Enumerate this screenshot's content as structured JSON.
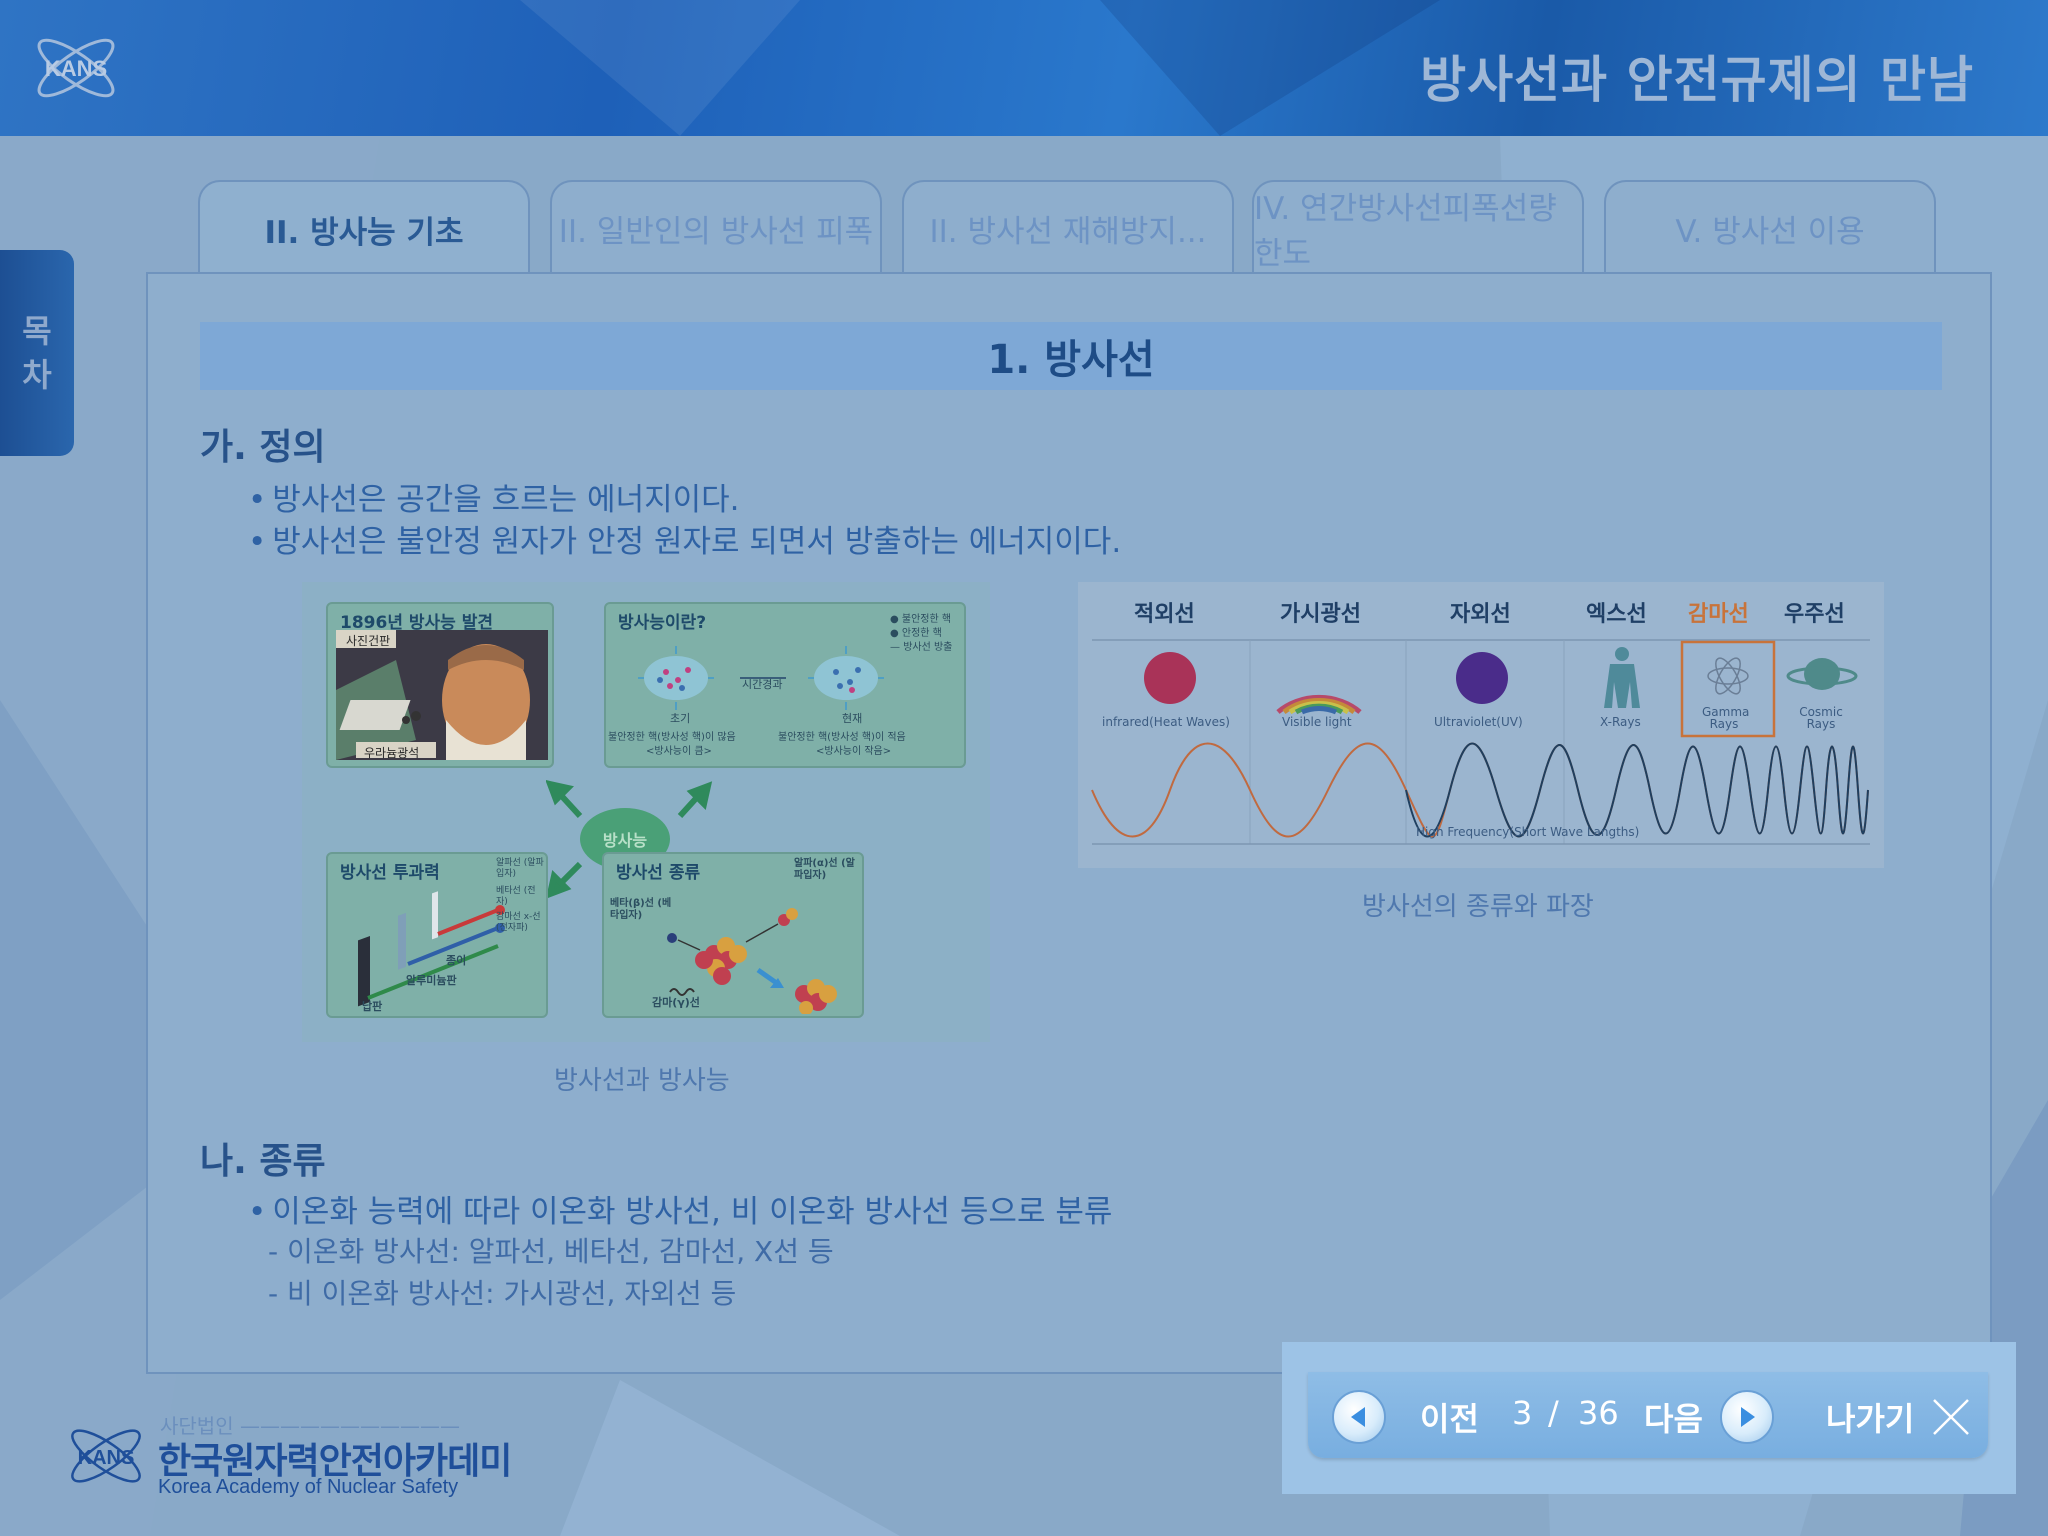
{
  "header": {
    "logo_text": "KANS",
    "title": "방사선과 안전규제의 만남"
  },
  "side_toc": {
    "line1": "목",
    "line2": "차"
  },
  "tabs": [
    {
      "label": "II. 방사능 기초",
      "active": true
    },
    {
      "label": "II. 일반인의 방사선 피폭",
      "active": false
    },
    {
      "label": "II. 방사선 재해방지...",
      "active": false
    },
    {
      "label": "IV. 연간방사선피폭선량한도",
      "active": false
    },
    {
      "label": "V. 방사선 이용",
      "active": false
    }
  ],
  "content": {
    "section_title": "1. 방사선",
    "definition": {
      "heading": "가. 정의",
      "bullets": [
        "방사선은 공간을 흐르는 에너지이다.",
        "방사선은 불안정 원자가 안정 원자로 되면서 방출하는 에너지이다."
      ]
    },
    "figure1": {
      "caption": "방사선과 방사능",
      "hub": "방사능",
      "card_discovery": {
        "title": "1896년 방사능 발견",
        "label_top": "사진건판",
        "label_bottom": "우라늄광석"
      },
      "card_what": {
        "title": "방사능이란?",
        "legend": [
          "불안정한 핵",
          "안정한 핵",
          "방사선 방출"
        ],
        "time_label": "시간경과",
        "left_label": "초기",
        "left_desc1": "불안정한 핵(방사성 핵)이 많음",
        "left_desc2": "<방사능이 큼>",
        "right_label": "현재",
        "right_desc1": "불안정한 핵(방사성 핵)이 적음",
        "right_desc2": "<방사능이 작음>"
      },
      "card_penetration": {
        "title": "방사선 투과력",
        "labels": [
          "알파선 (알파입자)",
          "베타선 (전자)",
          "감마선 x-선 (전자파)"
        ],
        "paper": "종이",
        "aluminum": "알루미늄판",
        "lead": "납판"
      },
      "card_types": {
        "title": "방사선 종류",
        "alpha": "알파(α)선 (알파입자)",
        "beta": "베타(β)선 (베타입자)",
        "gamma": "감마(γ)선"
      }
    },
    "figure2": {
      "caption": "방사선의 종류와 파장",
      "headers": [
        "적외선",
        "가시광선",
        "자외선",
        "엑스선",
        "감마선",
        "우주선"
      ],
      "labels": [
        "infrared(Heat Waves)",
        "Visible light",
        "Ultraviolet(UV)",
        "X-Rays",
        "Gamma Rays",
        "Cosmic Rays"
      ],
      "bottom_label": "High Frequency(Short Wave Langths)",
      "highlight_color": "#c8733a"
    },
    "types": {
      "heading": "나. 종류",
      "bullet": "이온화 능력에 따라 이온화 방사선, 비 이온화 방사선 등으로 분류",
      "sub1": "- 이온화 방사선: 알파선, 베타선, 감마선, X선 등",
      "sub2": "- 비 이온화 방사선: 가시광선, 자외선 등"
    }
  },
  "nav": {
    "prev_label": "이전",
    "current_page": "3",
    "separator": "/",
    "total_pages": "36",
    "next_label": "다음",
    "exit_label": "나가기"
  },
  "footer": {
    "small": "사단법인",
    "name_kr": "한국원자력안전아카데미",
    "name_en": "Korea Academy of Nuclear Safety",
    "logo_text": "KANS"
  }
}
